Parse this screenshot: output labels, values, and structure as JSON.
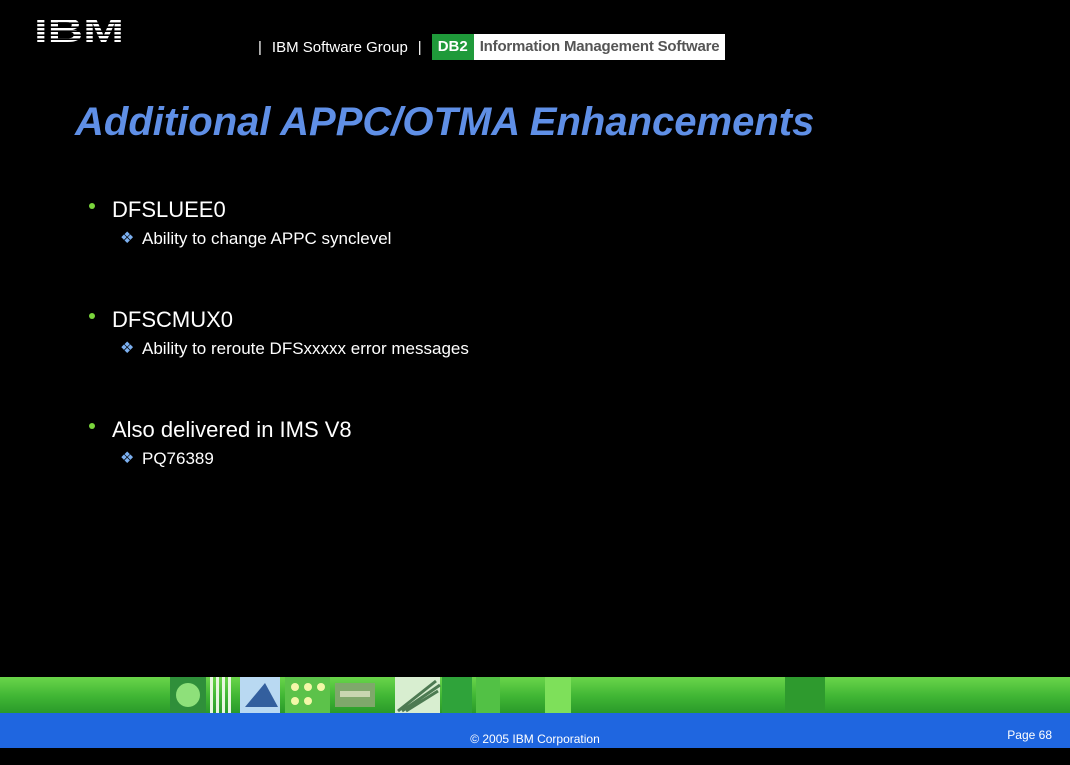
{
  "header": {
    "logo_text": "IBM",
    "separator": "|",
    "group": "IBM Software Group",
    "db2_badge": "DB2",
    "product": "Information Management Software"
  },
  "title": "Additional APPC/OTMA Enhancements",
  "bullets": [
    {
      "label": "DFSLUEE0",
      "sub": [
        "Ability to change APPC synclevel"
      ]
    },
    {
      "label": "DFSCMUX0",
      "sub": [
        "Ability to reroute DFSxxxxx error messages"
      ]
    },
    {
      "label": "Also delivered in IMS V8",
      "sub": [
        "PQ76389"
      ]
    }
  ],
  "footer": {
    "copyright": "© 2005 IBM Corporation",
    "page": "Page 68"
  },
  "colors": {
    "title": "#5f8fe6",
    "bullet_dot": "#7bd53c",
    "sub_bullet": "#7cb0f0",
    "footer_bar": "#1f66e0",
    "db2_badge": "#1f9a3a"
  },
  "icons": {
    "bullet": "dot-icon",
    "sub_bullet": "diamond-bullet-icon"
  }
}
